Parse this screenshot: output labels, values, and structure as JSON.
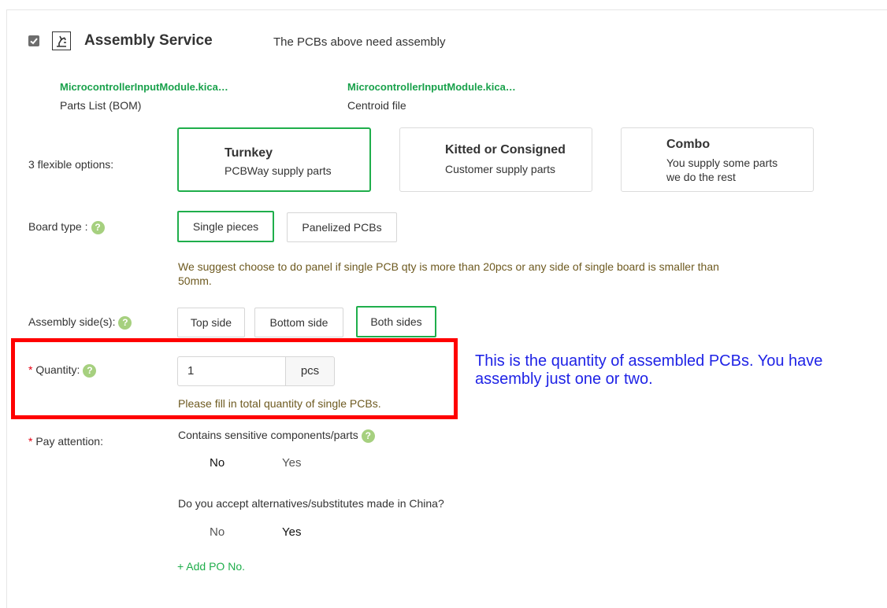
{
  "header": {
    "title": "Assembly Service",
    "subtitle": "The PCBs above need assembly",
    "checked": true
  },
  "files": [
    {
      "name": "MicrocontrollerInputModule.kica…",
      "type": "Parts List (BOM)"
    },
    {
      "name": "MicrocontrollerInputModule.kica…",
      "type": "Centroid file"
    }
  ],
  "options": {
    "label": "3 flexible options:",
    "items": [
      {
        "title": "Turnkey",
        "desc": "PCBWay supply parts",
        "desc2": "",
        "selected": true
      },
      {
        "title": "Kitted or Consigned",
        "desc": "Customer supply parts",
        "desc2": "",
        "selected": false
      },
      {
        "title": "Combo",
        "desc": "You supply some parts",
        "desc2": "we do the rest",
        "selected": false
      }
    ]
  },
  "board_type": {
    "label": "Board type :",
    "choices": [
      "Single pieces",
      "Panelized PCBs"
    ],
    "selected": "Single pieces",
    "hint_line1": "We suggest choose to do panel if single PCB qty is more than 20pcs or any side of single board is smaller than",
    "hint_line2": "50mm."
  },
  "assembly_side": {
    "label": "Assembly side(s):",
    "choices": [
      "Top side",
      "Bottom side",
      "Both sides"
    ],
    "selected": "Both sides"
  },
  "quantity": {
    "required_mark": "*",
    "label": "Quantity:",
    "value": "1",
    "unit": "pcs",
    "hint": "Please fill in total quantity of single PCBs."
  },
  "annotation": {
    "line1": "This is the quantity of assembled PCBs. You have",
    "line2": "assembly just one or two."
  },
  "pay_attention": {
    "required_mark": "*",
    "label": "Pay attention:",
    "q1": {
      "text": "Contains sensitive components/parts",
      "no": "No",
      "yes": "Yes",
      "selected": "No"
    },
    "q2": {
      "text": "Do you accept alternatives/substitutes made in China?",
      "no": "No",
      "yes": "Yes",
      "selected": "Yes"
    },
    "add_po": "+ Add PO No."
  },
  "help_glyph": "?",
  "colors": {
    "accent_green": "#1fae4b",
    "link_green": "#19a14b",
    "hint_brown": "#6e5a20",
    "required_red": "#e60012",
    "annotation_blue": "#1f23e6",
    "highlight_red": "#ff0000"
  }
}
